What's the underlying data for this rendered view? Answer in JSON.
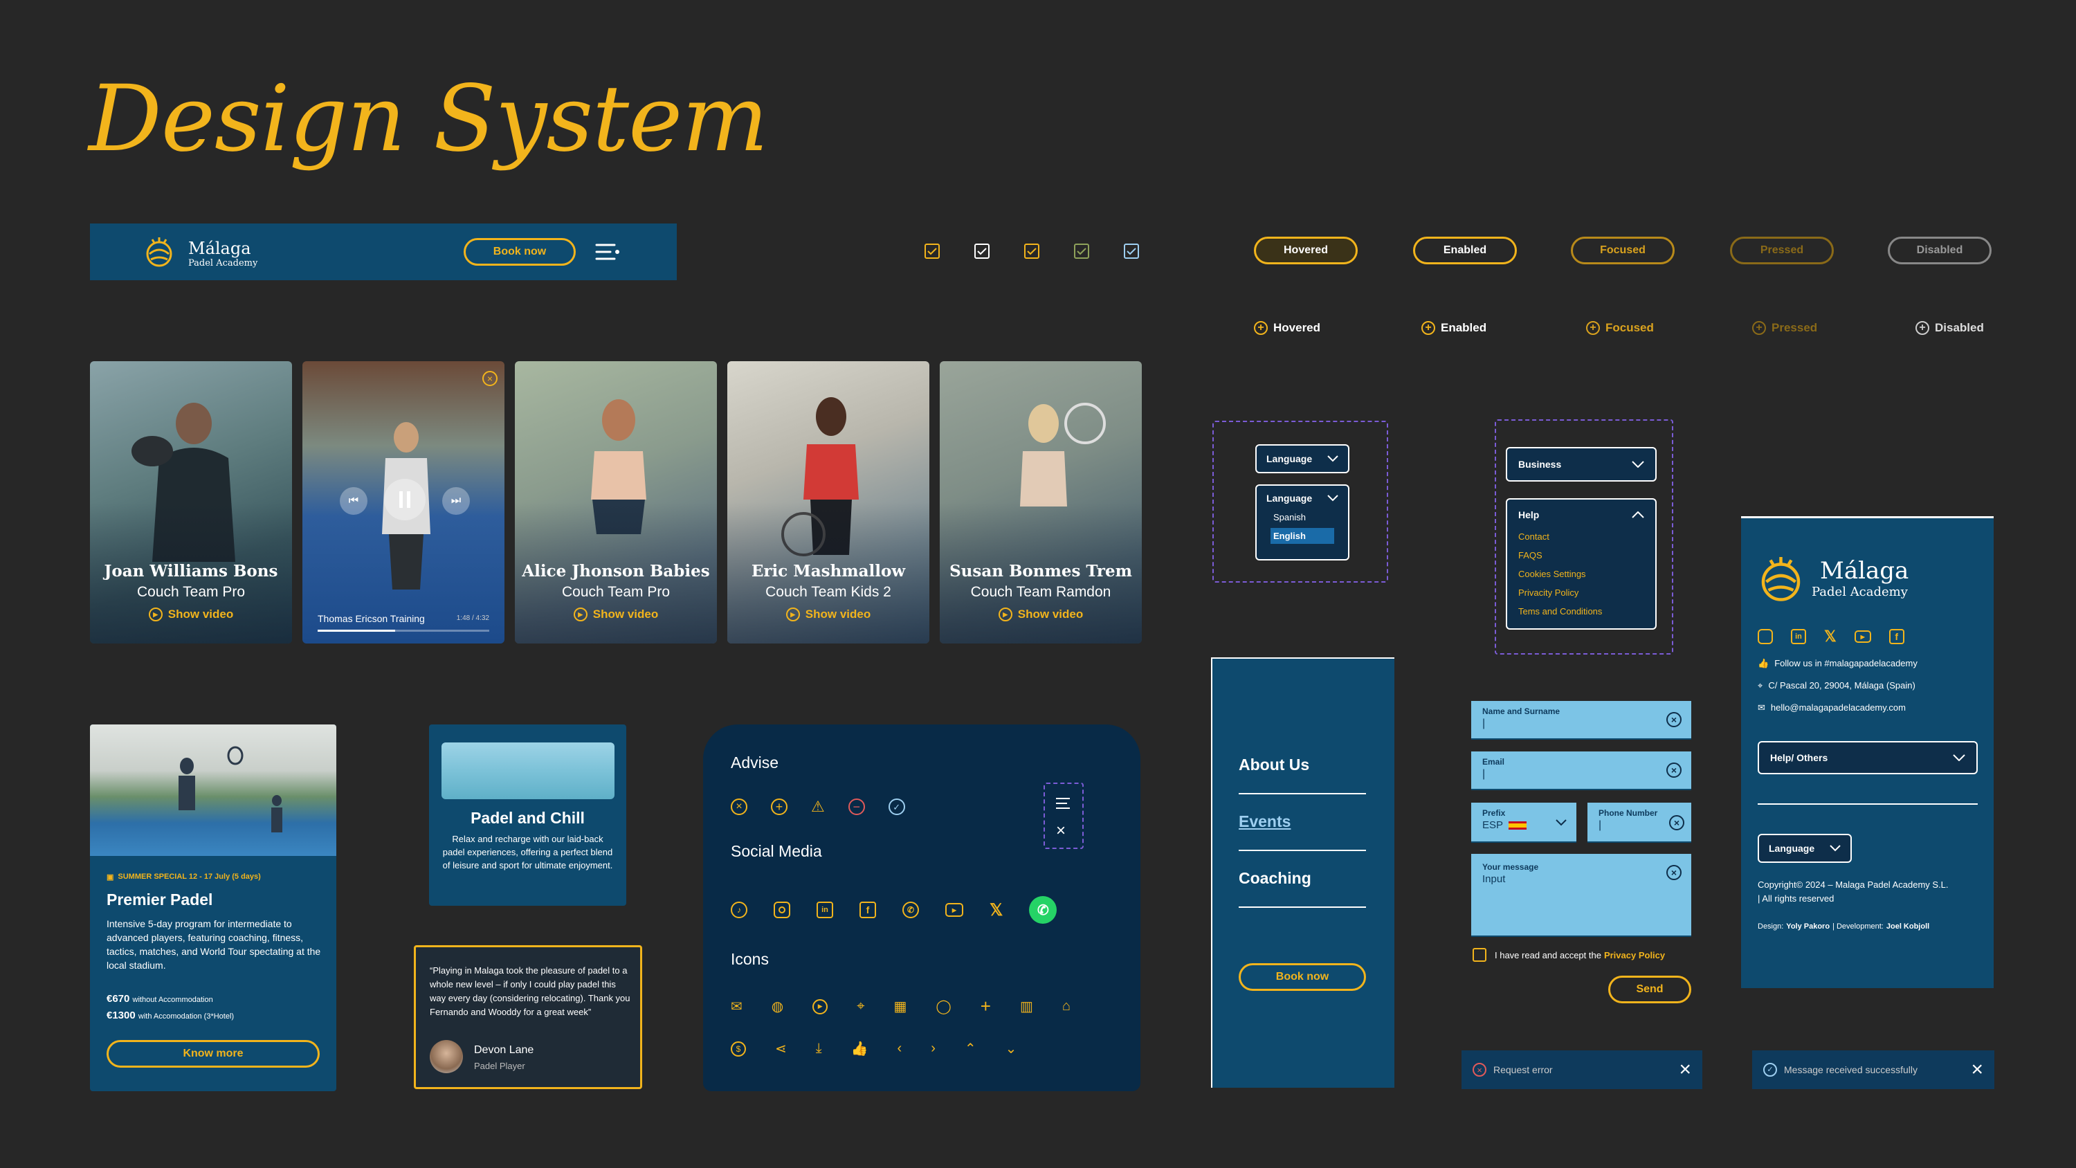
{
  "page_title": "Design System",
  "colors": {
    "background": "#272727",
    "accent": "#F2B41C",
    "blue": "#0E4A6E",
    "navy": "#082A47",
    "light_blue": "#7CC4E6",
    "purple_dash": "#7B5CD6"
  },
  "header": {
    "brand_name": "Málaga",
    "brand_sub": "Padel Academy",
    "book_label": "Book now",
    "menu_icon": "hamburger-menu-icon"
  },
  "checkboxes": {
    "count": 5,
    "icon": "checkmark-icon"
  },
  "state_buttons": [
    {
      "label": "Hovered"
    },
    {
      "label": "Enabled"
    },
    {
      "label": "Focused"
    },
    {
      "label": "Pressed"
    },
    {
      "label": "Disabled"
    }
  ],
  "link_buttons": [
    {
      "label": "Hovered"
    },
    {
      "label": "Enabled"
    },
    {
      "label": "Focused"
    },
    {
      "label": "Pressed"
    },
    {
      "label": "Disabled"
    }
  ],
  "video_cards": [
    {
      "name": "Joan Williams Bons",
      "role": "Couch Team Pro",
      "action": "Show video"
    },
    {
      "video_title": "Thomas Ericson Training",
      "time": "1:48 / 4:32"
    },
    {
      "name": "Alice Jhonson Babies",
      "role": "Couch Team Pro",
      "action": "Show video"
    },
    {
      "name": "Eric Mashmallow",
      "role": "Couch Team Kids 2",
      "action": "Show video"
    },
    {
      "name": "Susan Bonmes Trem",
      "role": "Couch Team Ramdon",
      "action": "Show video"
    }
  ],
  "language_dropdown": {
    "label": "Language",
    "options": [
      "Spanish",
      "English"
    ],
    "selected": "English"
  },
  "footer_dropdowns": {
    "business": "Business",
    "help": "Help",
    "help_items": [
      "Contact",
      "FAQS",
      "Cookies Settings",
      "Privacity Policy",
      "Tems and Conditions"
    ]
  },
  "footer_card": {
    "brand_name": "Málaga",
    "brand_sub": "Padel Academy",
    "social_icons": [
      "instagram-icon",
      "linkedin-icon",
      "x-icon",
      "youtube-icon",
      "facebook-icon"
    ],
    "follow": "Follow us in #malagapadelacademy",
    "address": "C/ Pascal 20, 29004, Málaga (Spain)",
    "email": "hello@malagapadelacademy.com",
    "help_dropdown": "Help/ Others",
    "language": "Language",
    "copyright": "Copyright© 2024 – Malaga Padel Academy S.L.",
    "rights": "| All rights reserved",
    "design_label": "Design:",
    "designer": "Yoly Pakoro",
    "dev_label": "| Development:",
    "developer": "Joel Kobjoll"
  },
  "promo_card": {
    "tag": "SUMMER SPECIAL 12 - 17 July (5 days)",
    "title": "Premier Padel",
    "desc": "Intensive 5-day program for intermediate to advanced players, featuring coaching, fitness, tactics, matches, and World Tour spectating at the local stadium.",
    "price1": "€670",
    "price1_note": "without Accommodation",
    "price2": "€1300",
    "price2_note": "with Accomodation (3*Hotel)",
    "button": "Know more"
  },
  "chill_card": {
    "title": "Padel and Chill",
    "desc": "Relax and recharge with our laid-back padel experiences, offering a perfect blend of leisure and sport for ultimate enjoyment."
  },
  "testimonial": {
    "quote": "“Playing in Malaga took the pleasure of padel to a whole new level – if only I could play padel this way every day (considering relocating). Thank you Fernando and Wooddy for a great week”",
    "name": "Devon Lane",
    "role": "Padel Player"
  },
  "icons_panel": {
    "advise_title": "Advise",
    "advise_icons": [
      "error-circle-icon",
      "add-circle-icon",
      "warning-icon",
      "minus-circle-icon",
      "check-circle-icon"
    ],
    "social_title": "Social Media",
    "social_icons": [
      "tiktok-icon",
      "instagram-icon",
      "linkedin-icon",
      "facebook-icon",
      "whatsapp-icon",
      "youtube-icon",
      "x-icon",
      "whatsapp-filled-icon"
    ],
    "icons_title": "Icons",
    "icons_row1": [
      "mail-icon",
      "palette-icon",
      "play-icon",
      "location-icon",
      "calendar-icon",
      "chat-icon",
      "plus-icon",
      "map-icon",
      "home-icon"
    ],
    "icons_row2": [
      "dollar-icon",
      "share-icon",
      "download-icon",
      "thumbs-up-icon",
      "chevron-left-icon",
      "chevron-right-icon",
      "chevron-up-icon",
      "chevron-down-icon"
    ]
  },
  "mobile_menu": {
    "items": [
      "About Us",
      "Events",
      "Coaching"
    ],
    "button": "Book now"
  },
  "form": {
    "name_label": "Name and Surname",
    "email_label": "Email",
    "prefix_label": "Prefix",
    "prefix_value": "ESP",
    "phone_label": "Phone Number",
    "message_label": "Your message",
    "message_value": "Input",
    "consent": "I have read and accept the",
    "consent_link": "Privacy Policy",
    "send": "Send"
  },
  "toasts": {
    "error": "Request error",
    "success": "Message received successfully"
  }
}
